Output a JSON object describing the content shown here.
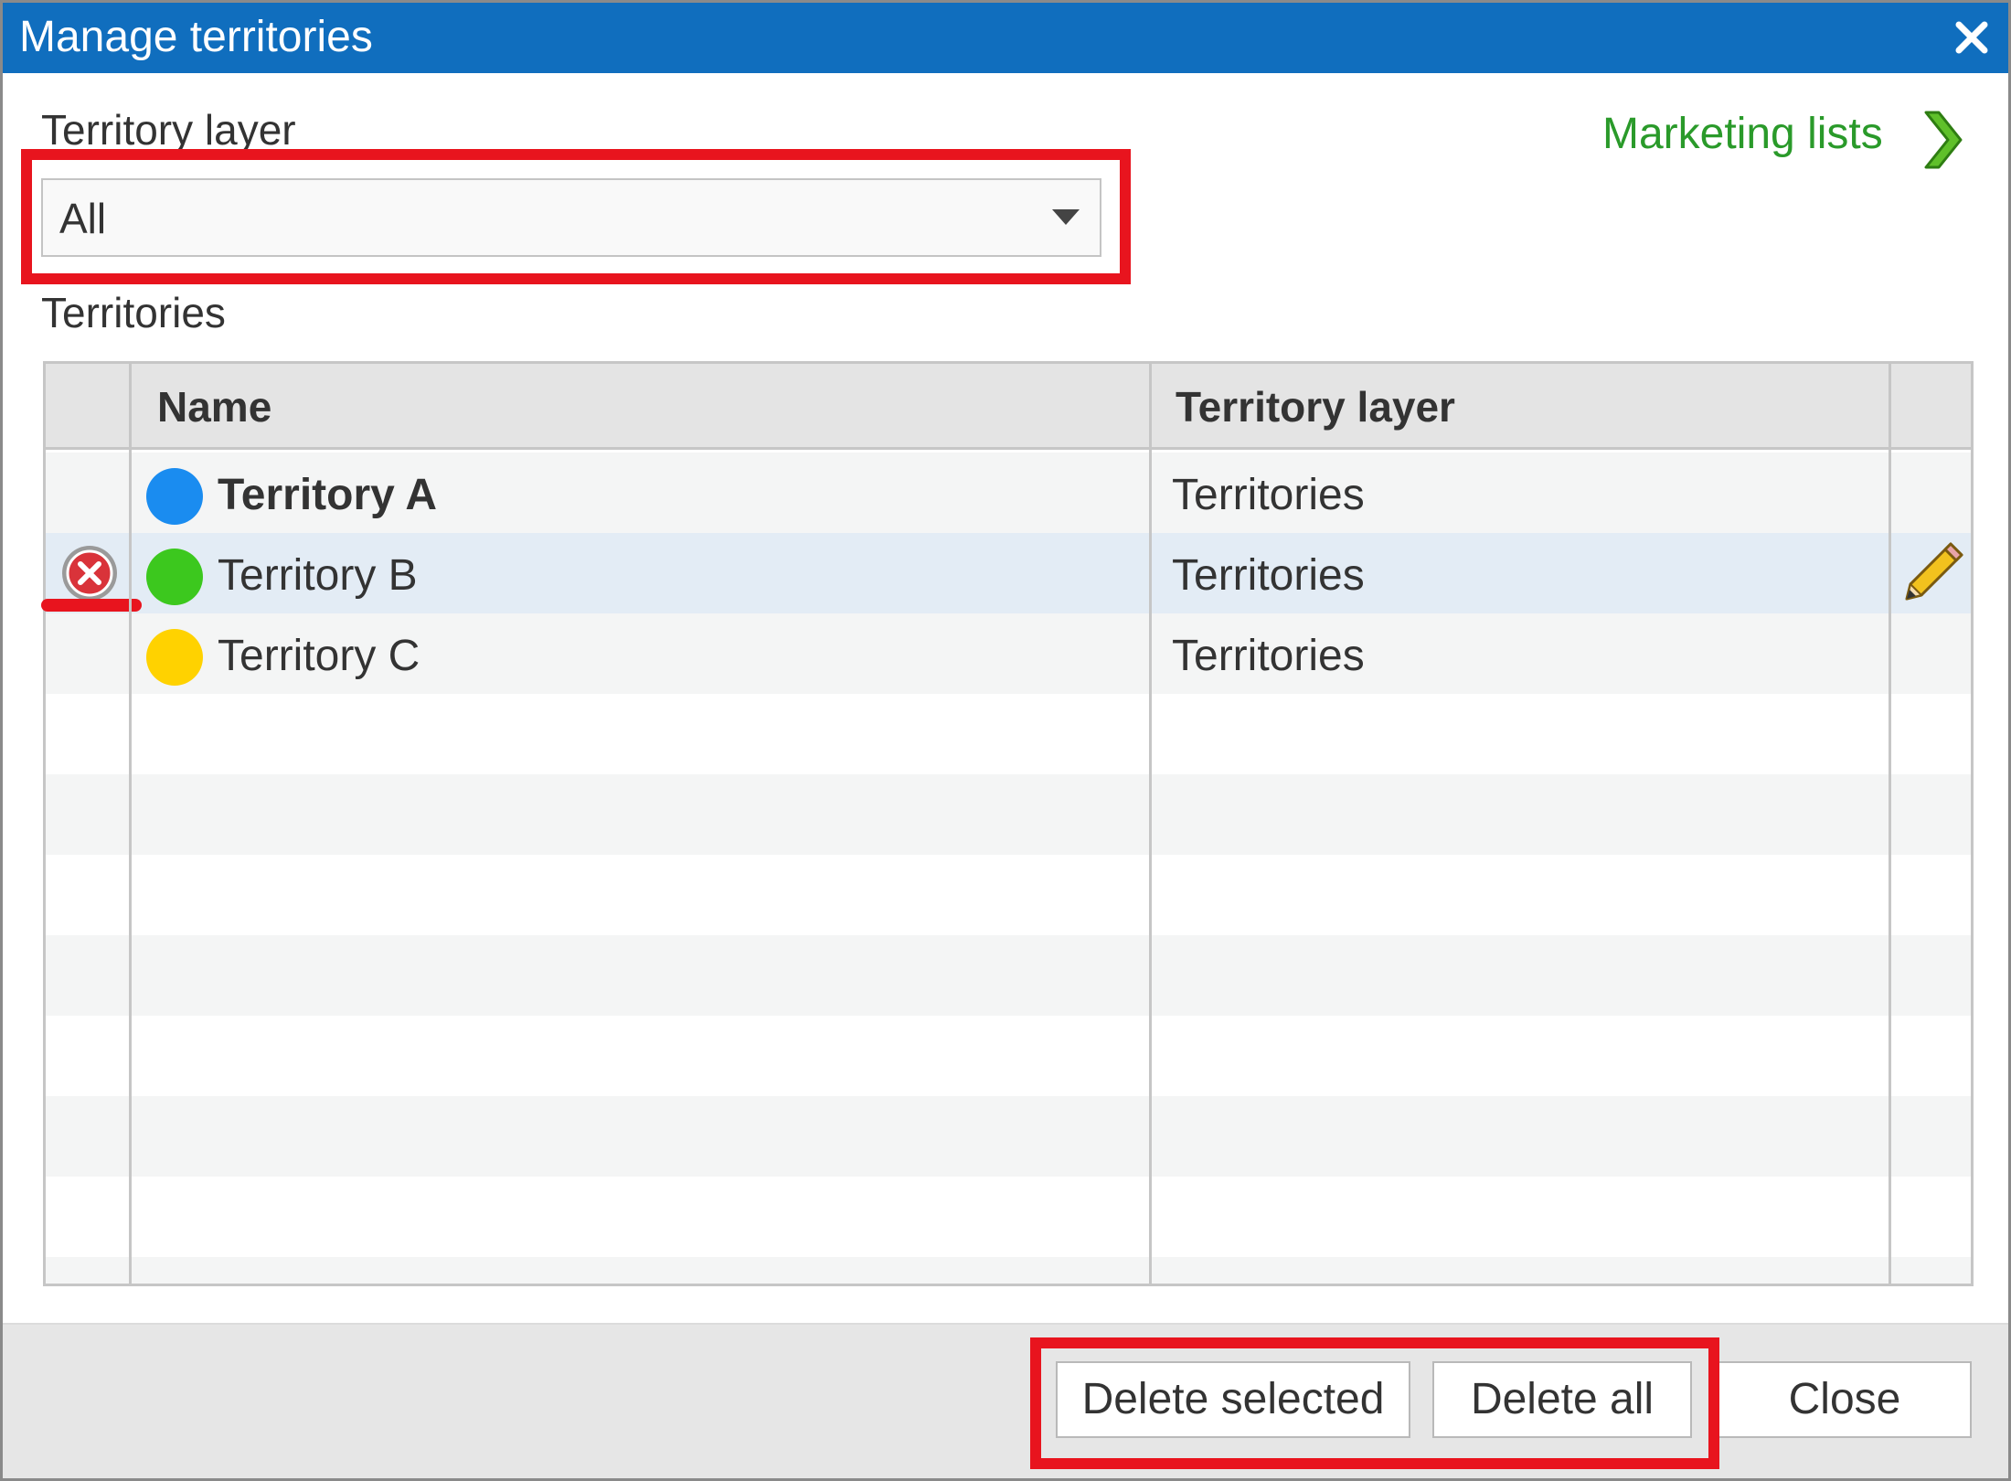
{
  "dialog": {
    "title": "Manage territories",
    "close_icon": "close-x-icon"
  },
  "filter": {
    "label": "Territory layer",
    "selected": "All",
    "arrow_icon": "dropdown-arrow-icon"
  },
  "marketing_link": {
    "label": "Marketing lists",
    "icon": "green-chevron-right-icon"
  },
  "territories_label": "Territories",
  "grid": {
    "columns": [
      "Name",
      "Territory layer"
    ],
    "rows": [
      {
        "name": "Territory A",
        "layer": "Territories",
        "color": "#1a8cf0",
        "bold": true
      },
      {
        "name": "Territory B",
        "layer": "Territories",
        "color": "#3cc81e",
        "selected": true,
        "delete_icon": "delete-x-circle-icon",
        "edit_icon": "pencil-icon"
      },
      {
        "name": "Territory C",
        "layer": "Territories",
        "color": "#ffd200"
      }
    ]
  },
  "buttons": {
    "delete_selected": "Delete selected",
    "delete_all": "Delete all",
    "close": "Close"
  },
  "colors": {
    "titlebar": "#106ebe",
    "highlight": "#e8141e",
    "link": "#2a9a2a",
    "selected_row": "#e3ecf5"
  }
}
